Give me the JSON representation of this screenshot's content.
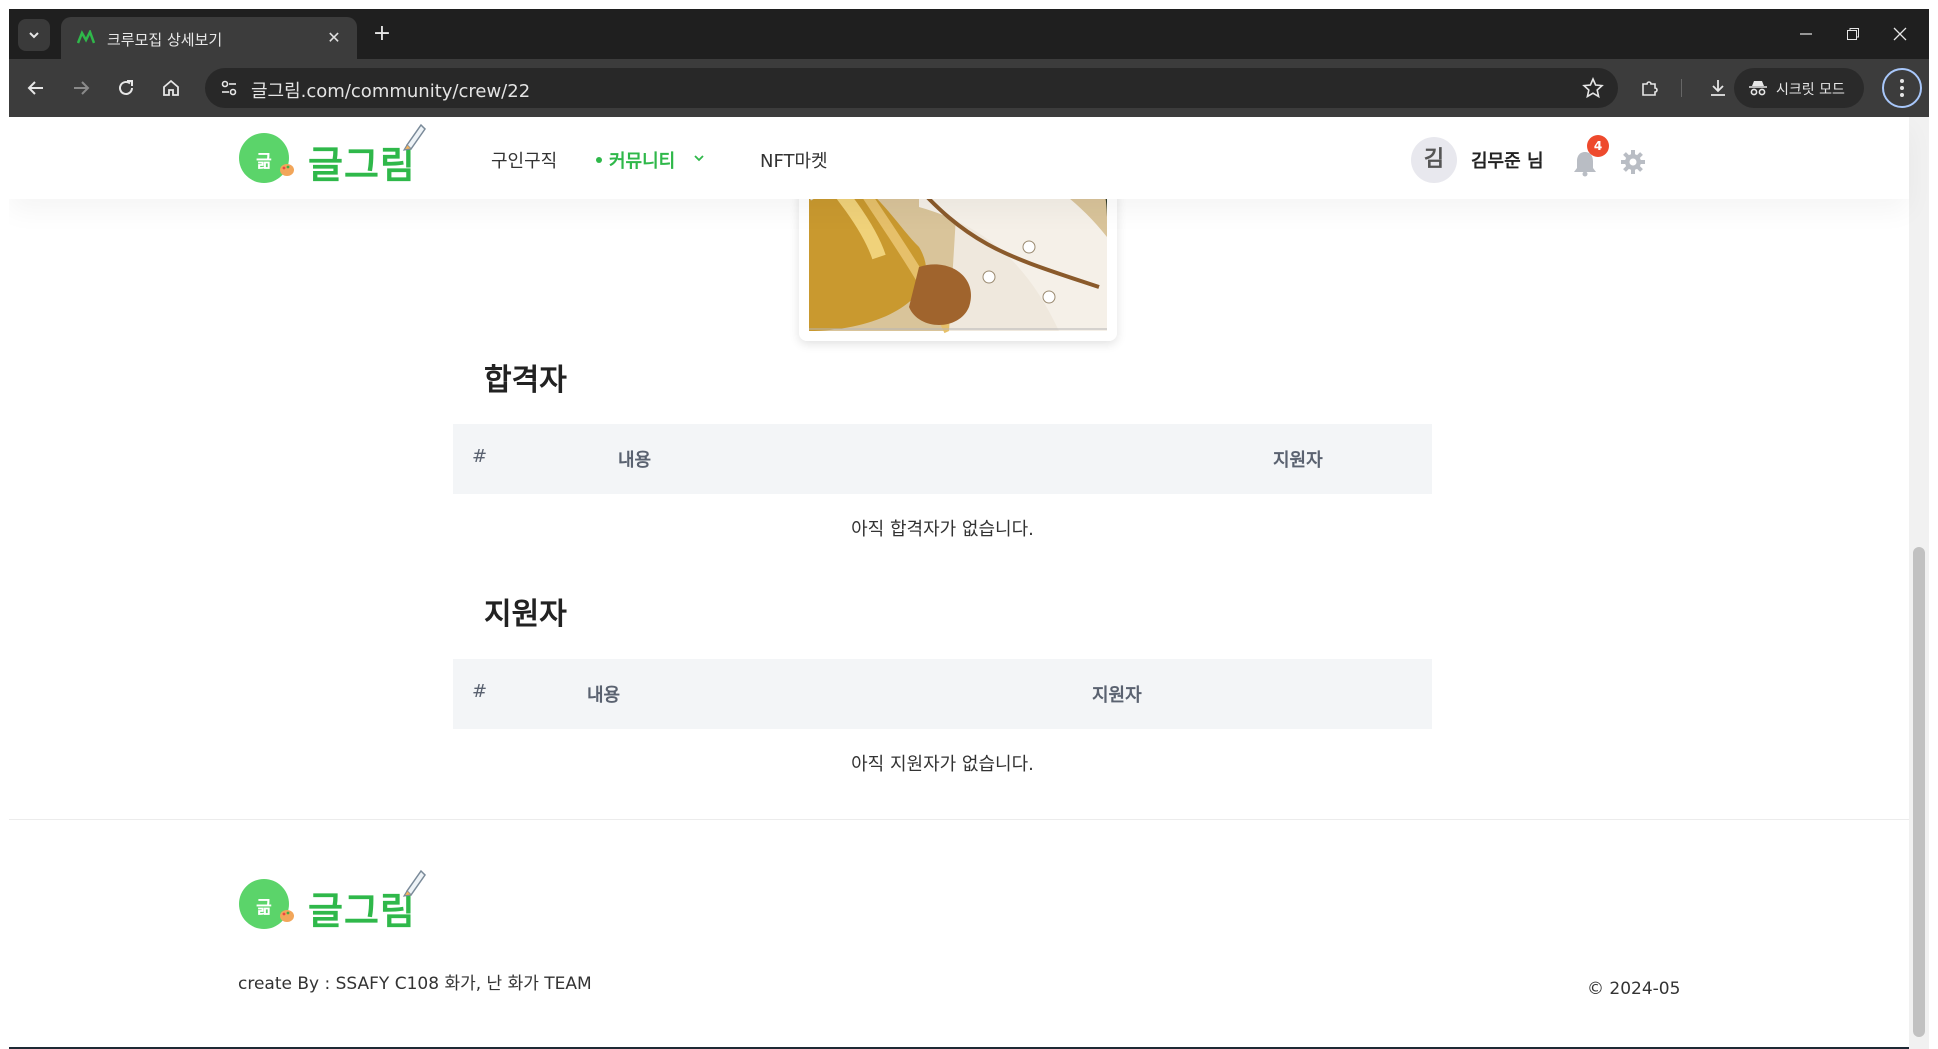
{
  "browser": {
    "tab_title": "크루모집 상세보기",
    "new_tab_label": "+",
    "url": "글그림.com/community/crew/22",
    "incognito_label": "시크릿 모드"
  },
  "site": {
    "logo_badge": "긂",
    "logo_text": "글그림",
    "nav": {
      "jobs": "구인구직",
      "community": "커뮤니티",
      "nft": "NFT마켓"
    },
    "user": {
      "avatar_initial": "김",
      "name": "김무준 님",
      "notification_count": "4"
    }
  },
  "accepted": {
    "title": "합격자",
    "col_num": "#",
    "col_content": "내용",
    "col_applicant": "지원자",
    "empty": "아직 합격자가 없습니다."
  },
  "applicants": {
    "title": "지원자",
    "col_num": "#",
    "col_content": "내용",
    "col_applicant": "지원자",
    "empty": "아직 지원자가 없습니다."
  },
  "footer": {
    "logo_badge": "긂",
    "logo_text": "글그림",
    "credit": "create By : SSAFY C108 화가, 난 화가 TEAM",
    "copyright": "© 2024-05"
  },
  "colors": {
    "brand_green": "#2fb84a",
    "badge_red": "#ee4a2d"
  }
}
